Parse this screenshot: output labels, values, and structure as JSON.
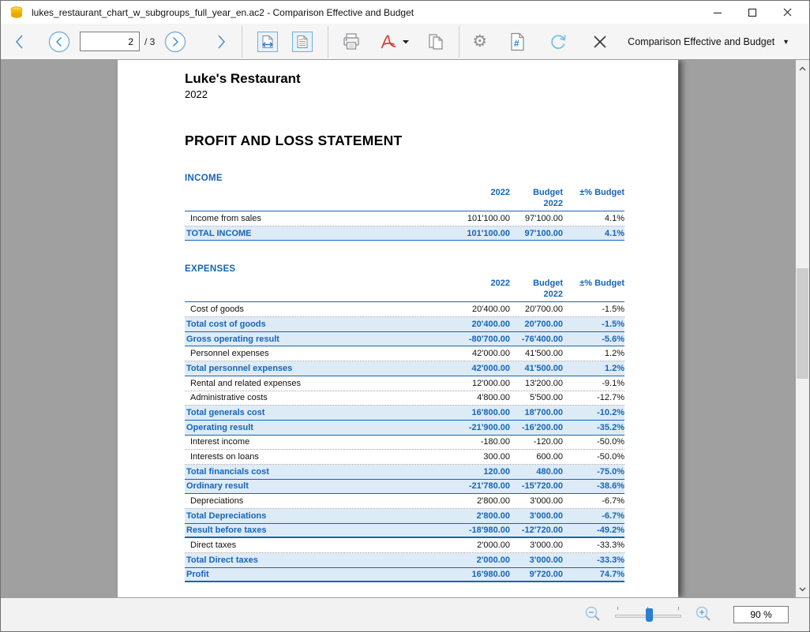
{
  "window": {
    "app_title": "lukes_restaurant_chart_w_subgroups_full_year_en.ac2 - Comparison Effective and Budget"
  },
  "toolbar": {
    "page_number": "2",
    "page_total_label": "/ 3",
    "view_selector_label": "Comparison Effective and Budget",
    "dropdown_caret": "▼",
    "gear_glyph": "⚙"
  },
  "statusbar": {
    "zoom_value": "90 %"
  },
  "colors": {
    "accent_blue": "#1565b7",
    "row_highlight": "#ddebf7",
    "toolbar_blue": "#2d7dd2",
    "preview_gray": "#a0a0a0"
  },
  "document": {
    "company": "Luke's Restaurant",
    "year": "2022",
    "report_title": "PROFIT AND LOSS STATEMENT",
    "sections": [
      {
        "name": "INCOME",
        "columns": [
          "2022",
          "Budget\n2022",
          "±% Budget"
        ],
        "rows": [
          {
            "label": "Income from sales",
            "current": "101'100.00",
            "budget": "97'100.00",
            "pct": "4.1%",
            "style": "plain",
            "sep": "dotted"
          },
          {
            "label": "TOTAL INCOME",
            "current": "101'100.00",
            "budget": "97'100.00",
            "pct": "4.1%",
            "style": "total",
            "sep": "solid"
          }
        ]
      },
      {
        "name": "EXPENSES",
        "columns": [
          "2022",
          "Budget\n2022",
          "±% Budget"
        ],
        "rows": [
          {
            "label": "Cost of goods",
            "current": "20'400.00",
            "budget": "20'700.00",
            "pct": "-1.5%",
            "style": "plain",
            "sep": "dotted"
          },
          {
            "label": "Total cost of goods",
            "current": "20'400.00",
            "budget": "20'700.00",
            "pct": "-1.5%",
            "style": "total",
            "sep": "solid"
          },
          {
            "label": "Gross operating result",
            "current": "-80'700.00",
            "budget": "-76'400.00",
            "pct": "-5.6%",
            "style": "total",
            "sep": "solid"
          },
          {
            "label": "Personnel expenses",
            "current": "42'000.00",
            "budget": "41'500.00",
            "pct": "1.2%",
            "style": "plain",
            "sep": "dotted"
          },
          {
            "label": "Total personnel expenses",
            "current": "42'000.00",
            "budget": "41'500.00",
            "pct": "1.2%",
            "style": "total",
            "sep": "solid"
          },
          {
            "label": "Rental and related expenses",
            "current": "12'000.00",
            "budget": "13'200.00",
            "pct": "-9.1%",
            "style": "plain",
            "sep": "dotted"
          },
          {
            "label": "Administrative costs",
            "current": "4'800.00",
            "budget": "5'500.00",
            "pct": "-12.7%",
            "style": "plain",
            "sep": "dotted"
          },
          {
            "label": "Total generals cost",
            "current": "16'800.00",
            "budget": "18'700.00",
            "pct": "-10.2%",
            "style": "total",
            "sep": "solid"
          },
          {
            "label": "Operating result",
            "current": "-21'900.00",
            "budget": "-16'200.00",
            "pct": "-35.2%",
            "style": "total",
            "sep": "solid"
          },
          {
            "label": "Interest income",
            "current": "-180.00",
            "budget": "-120.00",
            "pct": "-50.0%",
            "style": "plain",
            "sep": "dotted"
          },
          {
            "label": "Interests on loans",
            "current": "300.00",
            "budget": "600.00",
            "pct": "-50.0%",
            "style": "plain",
            "sep": "dotted"
          },
          {
            "label": "Total financials cost",
            "current": "120.00",
            "budget": "480.00",
            "pct": "-75.0%",
            "style": "total",
            "sep": "solid"
          },
          {
            "label": "Ordinary result",
            "current": "-21'780.00",
            "budget": "-15'720.00",
            "pct": "-38.6%",
            "style": "total",
            "sep": "solid"
          },
          {
            "label": "Depreciations",
            "current": "2'800.00",
            "budget": "3'000.00",
            "pct": "-6.7%",
            "style": "plain",
            "sep": "dotted"
          },
          {
            "label": "Total Depreciations",
            "current": "2'800.00",
            "budget": "3'000.00",
            "pct": "-6.7%",
            "style": "total",
            "sep": "solid"
          },
          {
            "label": "Result before taxes",
            "current": "-18'980.00",
            "budget": "-12'720.00",
            "pct": "-49.2%",
            "style": "total",
            "sep": "thick"
          },
          {
            "label": "Direct taxes",
            "current": "2'000.00",
            "budget": "3'000.00",
            "pct": "-33.3%",
            "style": "plain",
            "sep": "dotted"
          },
          {
            "label": "Total Direct taxes",
            "current": "2'000.00",
            "budget": "3'000.00",
            "pct": "-33.3%",
            "style": "total",
            "sep": "solid"
          },
          {
            "label": "Profit",
            "current": "16'980.00",
            "budget": "9'720.00",
            "pct": "74.7%",
            "style": "total",
            "sep": "thick"
          }
        ]
      }
    ]
  }
}
